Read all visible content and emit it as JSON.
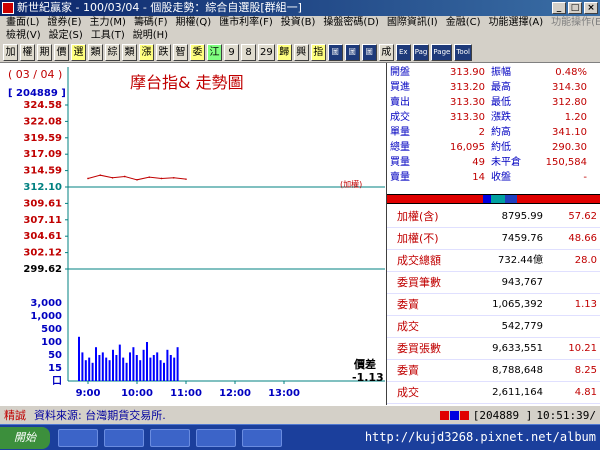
{
  "window": {
    "title": "新世紀贏家 - 100/03/04 - 個股走勢：綜合自選股[群組一]",
    "minimize": "_",
    "maximize": "□",
    "close": "×"
  },
  "menu": {
    "row1": [
      "畫面(L)",
      "證券(E)",
      "主力(M)",
      "籌碼(F)",
      "期權(Q)",
      "匯市利率(F)",
      "投資(B)",
      "操盤密碼(D)",
      "國際資訊(I)",
      "金融(C)",
      "功能選擇(A)",
      "功能操作(E)"
    ],
    "row2": [
      "檢視(V)",
      "設定(S)",
      "工具(T)",
      "說明(H)"
    ]
  },
  "toolbar": [
    "加",
    "權",
    "期",
    "價",
    "選",
    "類",
    "綜",
    "類",
    "漲",
    "跌",
    "智",
    "委",
    "江",
    "9",
    "8",
    "29",
    "歸",
    "興",
    "指",
    "圖",
    "圖",
    "圖",
    "成",
    "Ex",
    "Pag",
    "Page",
    "Tool"
  ],
  "chart": {
    "date": "( 03 / 04 )",
    "code": "[ 204889 ]",
    "title": "摩台指&  走勢圖",
    "ref_label": "(加權)",
    "price_ticks": [
      "324.58",
      "322.08",
      "319.59",
      "317.09",
      "314.59",
      "312.10",
      "309.61",
      "307.11",
      "304.61",
      "302.12",
      "299.62"
    ],
    "volume_ticks": [
      "3,000",
      "1,000",
      "500",
      "100",
      "50",
      "15",
      "口"
    ],
    "time_ticks": [
      "9:00",
      "10:00",
      "11:00",
      "12:00",
      "13:00"
    ],
    "diff_label": "價差",
    "diff_value": "-1.13",
    "colors": {
      "bg": "#ffffff",
      "price_line": "#c00000",
      "ref_line": "#008080",
      "volume": "#0000ff",
      "axis": "#008080"
    }
  },
  "chart_data": {
    "type": "line",
    "title": "摩台指&  走勢圖",
    "xlabel": "",
    "ylabel": "",
    "ylim": [
      299.62,
      324.58
    ],
    "reference": 312.1,
    "x": [
      "9:00",
      "9:15",
      "9:30",
      "9:45",
      "10:00",
      "10:15",
      "10:30",
      "10:45",
      "11:00"
    ],
    "series": [
      {
        "values": [
          313.4,
          313.9,
          313.5,
          313.7,
          313.2,
          313.6,
          313.4,
          313.5,
          313.3
        ]
      }
    ],
    "volume": {
      "ylim": [
        0,
        3000
      ],
      "values": [
        1700,
        1100,
        800,
        900,
        700,
        1300,
        1000,
        1100,
        900,
        800,
        1200,
        1000,
        1400,
        900,
        700,
        1100,
        1300,
        1000,
        800,
        1200,
        1500,
        900,
        1000,
        1100,
        800,
        700,
        1200,
        1000,
        900,
        1300
      ]
    }
  },
  "quotes": {
    "rows": [
      {
        "l1": "開盤",
        "v1": "313.90",
        "l2": "振幅",
        "v2": "0.48%"
      },
      {
        "l1": "買進",
        "v1": "313.20",
        "l2": "最高",
        "v2": "314.30"
      },
      {
        "l1": "賣出",
        "v1": "313.30",
        "l2": "最低",
        "v2": "312.80"
      },
      {
        "l1": "成交",
        "v1": "313.30",
        "l2": "漲跌",
        "v2": "1.20"
      },
      {
        "l1": "單量",
        "v1": "2",
        "l2": "約高",
        "v2": "341.10"
      },
      {
        "l1": "總量",
        "v1": "16,095",
        "l2": "約低",
        "v2": "290.30"
      },
      {
        "l1": "買量",
        "v1": "49",
        "l2": "未平倉",
        "v2": "150,584"
      },
      {
        "l1": "賣量",
        "v1": "14",
        "l2": "收盤",
        "v2": "-"
      }
    ],
    "index": [
      {
        "label": "加權(含)",
        "value": "8795.99",
        "change": "57.62"
      },
      {
        "label": "加權(不)",
        "value": "7459.76",
        "change": "48.66"
      },
      {
        "label": "成交總額",
        "value": "732.44億",
        "change": "28.0"
      },
      {
        "label": "委買筆數",
        "value": "943,767",
        "change": ""
      },
      {
        "label": "委賣",
        "value": "1,065,392",
        "change": "1.13"
      },
      {
        "label": "成交",
        "value": "542,779",
        "change": ""
      },
      {
        "label": "委買張數",
        "value": "9,633,551",
        "change": "10.21"
      },
      {
        "label": "委賣",
        "value": "8,788,648",
        "change": "8.25"
      },
      {
        "label": "成交",
        "value": "2,611,164",
        "change": "4.81"
      }
    ]
  },
  "status": {
    "tag": "精誠",
    "source": "資料來源: 台灣期貨交易所.",
    "code": "[204889 ]",
    "time": "10:51:39/"
  },
  "taskbar": {
    "start": "開始",
    "url": "http://kujd3268.pixnet.net/album"
  }
}
